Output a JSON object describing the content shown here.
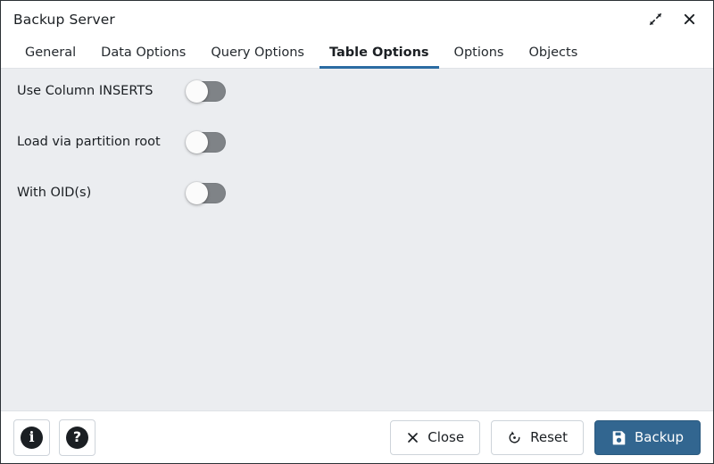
{
  "window": {
    "title": "Backup Server",
    "expand_icon": "expand-diagonal-icon",
    "close_icon": "close-icon"
  },
  "tabs": [
    {
      "label": "General",
      "active": false
    },
    {
      "label": "Data Options",
      "active": false
    },
    {
      "label": "Query Options",
      "active": false
    },
    {
      "label": "Table Options",
      "active": true
    },
    {
      "label": "Options",
      "active": false
    },
    {
      "label": "Objects",
      "active": false
    }
  ],
  "fields": [
    {
      "label": "Use Column INSERTS",
      "toggle_state": "off"
    },
    {
      "label": "Load via partition root",
      "toggle_state": "off"
    },
    {
      "label": "With OID(s)",
      "toggle_state": "off"
    }
  ],
  "footer": {
    "info_button": {
      "icon": "info-circle-icon",
      "glyph": "i"
    },
    "help_button": {
      "icon": "question-circle-icon",
      "glyph": "?"
    },
    "close_button": {
      "label": "Close",
      "icon": "close-x-icon"
    },
    "reset_button": {
      "label": "Reset",
      "icon": "reset-circular-arrow-icon"
    },
    "backup_button": {
      "label": "Backup",
      "icon": "save-floppy-icon"
    }
  },
  "colors": {
    "accent": "#2b6ca3",
    "primary_button": "#326690",
    "body_background": "#ebedf0",
    "toggle_off_track": "#7f8387",
    "border": "#ced4da"
  }
}
